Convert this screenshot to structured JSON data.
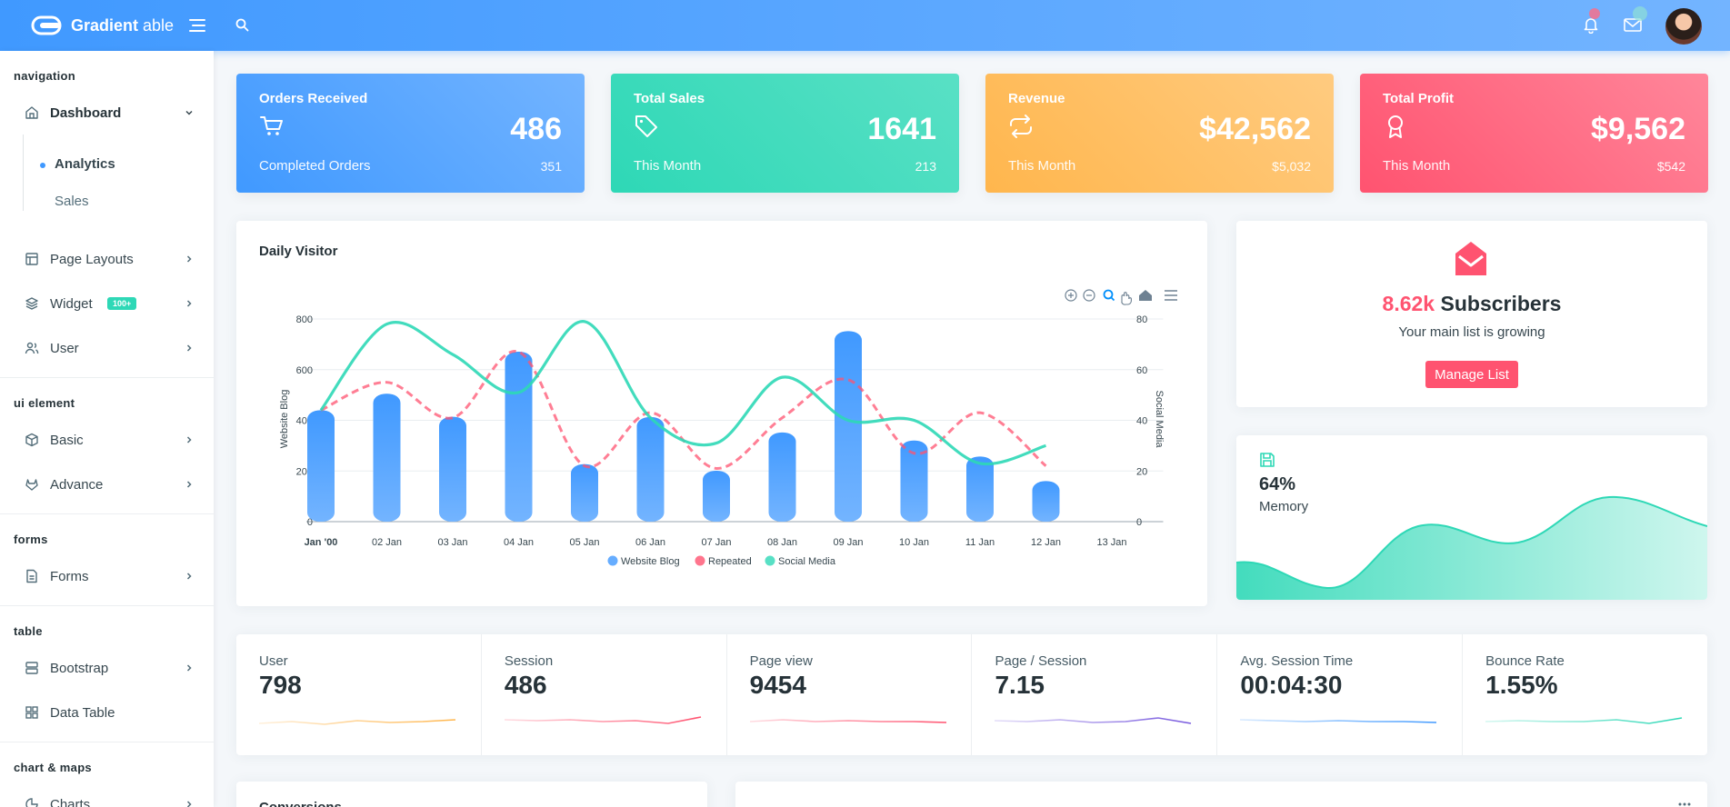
{
  "app": {
    "brand_bold": "Gradient",
    "brand_light": "able"
  },
  "sidebar": {
    "caption_navigation": "navigation",
    "dashboard": "Dashboard",
    "sub_analytics": "Analytics",
    "sub_sales": "Sales",
    "page_layouts": "Page Layouts",
    "widget": "Widget",
    "widget_badge": "100+",
    "user": "User",
    "caption_ui": "ui element",
    "basic": "Basic",
    "advance": "Advance",
    "caption_forms": "forms",
    "forms": "Forms",
    "caption_table": "table",
    "bootstrap": "Bootstrap",
    "data_table": "Data Table",
    "caption_charts": "chart & maps",
    "charts": "Charts"
  },
  "stats": [
    {
      "title": "Orders Received",
      "value": "486",
      "left": "Completed Orders",
      "right": "351",
      "icon": "cart-icon"
    },
    {
      "title": "Total Sales",
      "value": "1641",
      "left": "This Month",
      "right": "213",
      "icon": "tag-icon"
    },
    {
      "title": "Revenue",
      "value": "$42,562",
      "left": "This Month",
      "right": "$5,032",
      "icon": "repeat-icon"
    },
    {
      "title": "Total Profit",
      "value": "$9,562",
      "left": "This Month",
      "right": "$542",
      "icon": "award-icon"
    }
  ],
  "colors": {
    "blue": "#4099ff",
    "green": "#2ed8b6",
    "orange": "#ffb64d",
    "red": "#ff5370"
  },
  "daily": {
    "title": "Daily Visitor"
  },
  "chart_data": {
    "type": "bar",
    "categories": [
      "Jan '00",
      "02 Jan",
      "03 Jan",
      "04 Jan",
      "05 Jan",
      "06 Jan",
      "07 Jan",
      "08 Jan",
      "09 Jan",
      "10 Jan",
      "11 Jan",
      "12 Jan"
    ],
    "x_ticks": [
      "Jan '00",
      "02 Jan",
      "03 Jan",
      "04 Jan",
      "05 Jan",
      "06 Jan",
      "07 Jan",
      "08 Jan",
      "09 Jan",
      "10 Jan",
      "11 Jan",
      "12 Jan",
      "13 Jan"
    ],
    "ylabel": "Website Blog",
    "y2label": "Social Media",
    "ylim": [
      0,
      800
    ],
    "y2lim": [
      0,
      80
    ],
    "y_ticks": [
      "0",
      "200",
      "400",
      "600",
      "800"
    ],
    "y2_ticks": [
      "0",
      "20",
      "40",
      "60",
      "80"
    ],
    "legend": "bottom",
    "grid": true,
    "series": [
      {
        "name": "Website Blog",
        "type": "bar",
        "axis": "left",
        "color": "#4099ff",
        "values": [
          440,
          505,
          414,
          671,
          227,
          413,
          201,
          352,
          752,
          320,
          257,
          160
        ]
      },
      {
        "name": "Repeated",
        "type": "line-dashed",
        "axis": "right",
        "color": "#ff5370",
        "values": [
          44,
          55,
          41,
          67,
          22,
          43,
          21,
          41,
          56,
          27,
          43,
          22
        ]
      },
      {
        "name": "Social Media",
        "type": "line",
        "axis": "right",
        "color": "#2ed8b6",
        "values": [
          44,
          78,
          66,
          51,
          79,
          41,
          31,
          57,
          40,
          40,
          23,
          30
        ]
      }
    ]
  },
  "subs": {
    "count": "8.62k",
    "label": "Subscribers",
    "desc": "Your main list is growing",
    "button": "Manage List"
  },
  "memory": {
    "value": "64%",
    "label": "Memory"
  },
  "minis": [
    {
      "label": "User",
      "value": "798",
      "color": "#ffb64d"
    },
    {
      "label": "Session",
      "value": "486",
      "color": "#ff5370"
    },
    {
      "label": "Page view",
      "value": "9454",
      "color": "#ff5370"
    },
    {
      "label": "Page / Session",
      "value": "7.15",
      "color": "#7759de"
    },
    {
      "label": "Avg. Session Time",
      "value": "00:04:30",
      "color": "#4099ff"
    },
    {
      "label": "Bounce Rate",
      "value": "1.55%",
      "color": "#2ed8b6"
    }
  ],
  "conversions": {
    "title": "Conversions"
  }
}
